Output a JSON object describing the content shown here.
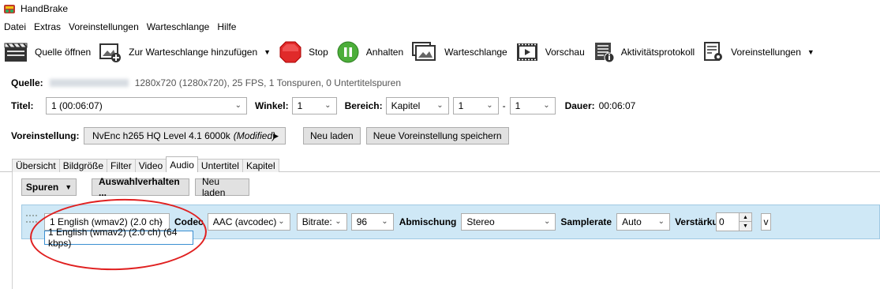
{
  "window": {
    "title": "HandBrake"
  },
  "menu": [
    "Datei",
    "Extras",
    "Voreinstellungen",
    "Warteschlange",
    "Hilfe"
  ],
  "toolbar": {
    "open_source": "Quelle öffnen",
    "add_queue": "Zur Warteschlange hinzufügen",
    "stop": "Stop",
    "pause": "Anhalten",
    "queue": "Warteschlange",
    "preview": "Vorschau",
    "activity_log": "Aktivitätsprotokoll",
    "presets": "Voreinstellungen"
  },
  "source": {
    "label": "Quelle:",
    "info": "1280x720 (1280x720), 25 FPS, 1 Tonspuren, 0 Untertitelspuren"
  },
  "title_row": {
    "title_label": "Titel:",
    "title_value": "1 (00:06:07)",
    "angle_label": "Winkel:",
    "angle_value": "1",
    "range_label": "Bereich:",
    "range_type": "Kapitel",
    "range_start": "1",
    "range_sep": "-",
    "range_end": "1",
    "duration_label": "Dauer:",
    "duration_value": "00:06:07"
  },
  "preset_row": {
    "label": "Voreinstellung:",
    "value": "NvEnc h265 HQ Level 4.1 6000k",
    "modified": "(Modified)",
    "reload": "Neu laden",
    "save_new": "Neue Voreinstellung speichern"
  },
  "tabs": [
    "Übersicht",
    "Bildgröße",
    "Filter",
    "Video",
    "Audio",
    "Untertitel",
    "Kapitel"
  ],
  "active_tab": "Audio",
  "audio": {
    "tracks_button": "Spuren",
    "selection_behavior": "Auswahlverhalten ...",
    "reload": "Neu laden",
    "track": {
      "source": "1 English (wmav2) (2.0 ch)",
      "codec_label": "Codec",
      "codec_value": "AAC (avcodec)",
      "bitrate_mode": "Bitrate:",
      "bitrate_value": "96",
      "mixdown_label": "Abmischung",
      "mixdown_value": "Stereo",
      "samplerate_label": "Samplerate",
      "samplerate_value": "Auto",
      "gain_label": "Verstärkung",
      "gain_value": "0",
      "expand": "v"
    },
    "dropdown_option": "1 English (wmav2) (2.0 ch) (64 kbps)"
  },
  "colors": {
    "annotation_ring": "#e02020",
    "track_row_bg": "#cfe8f6"
  }
}
